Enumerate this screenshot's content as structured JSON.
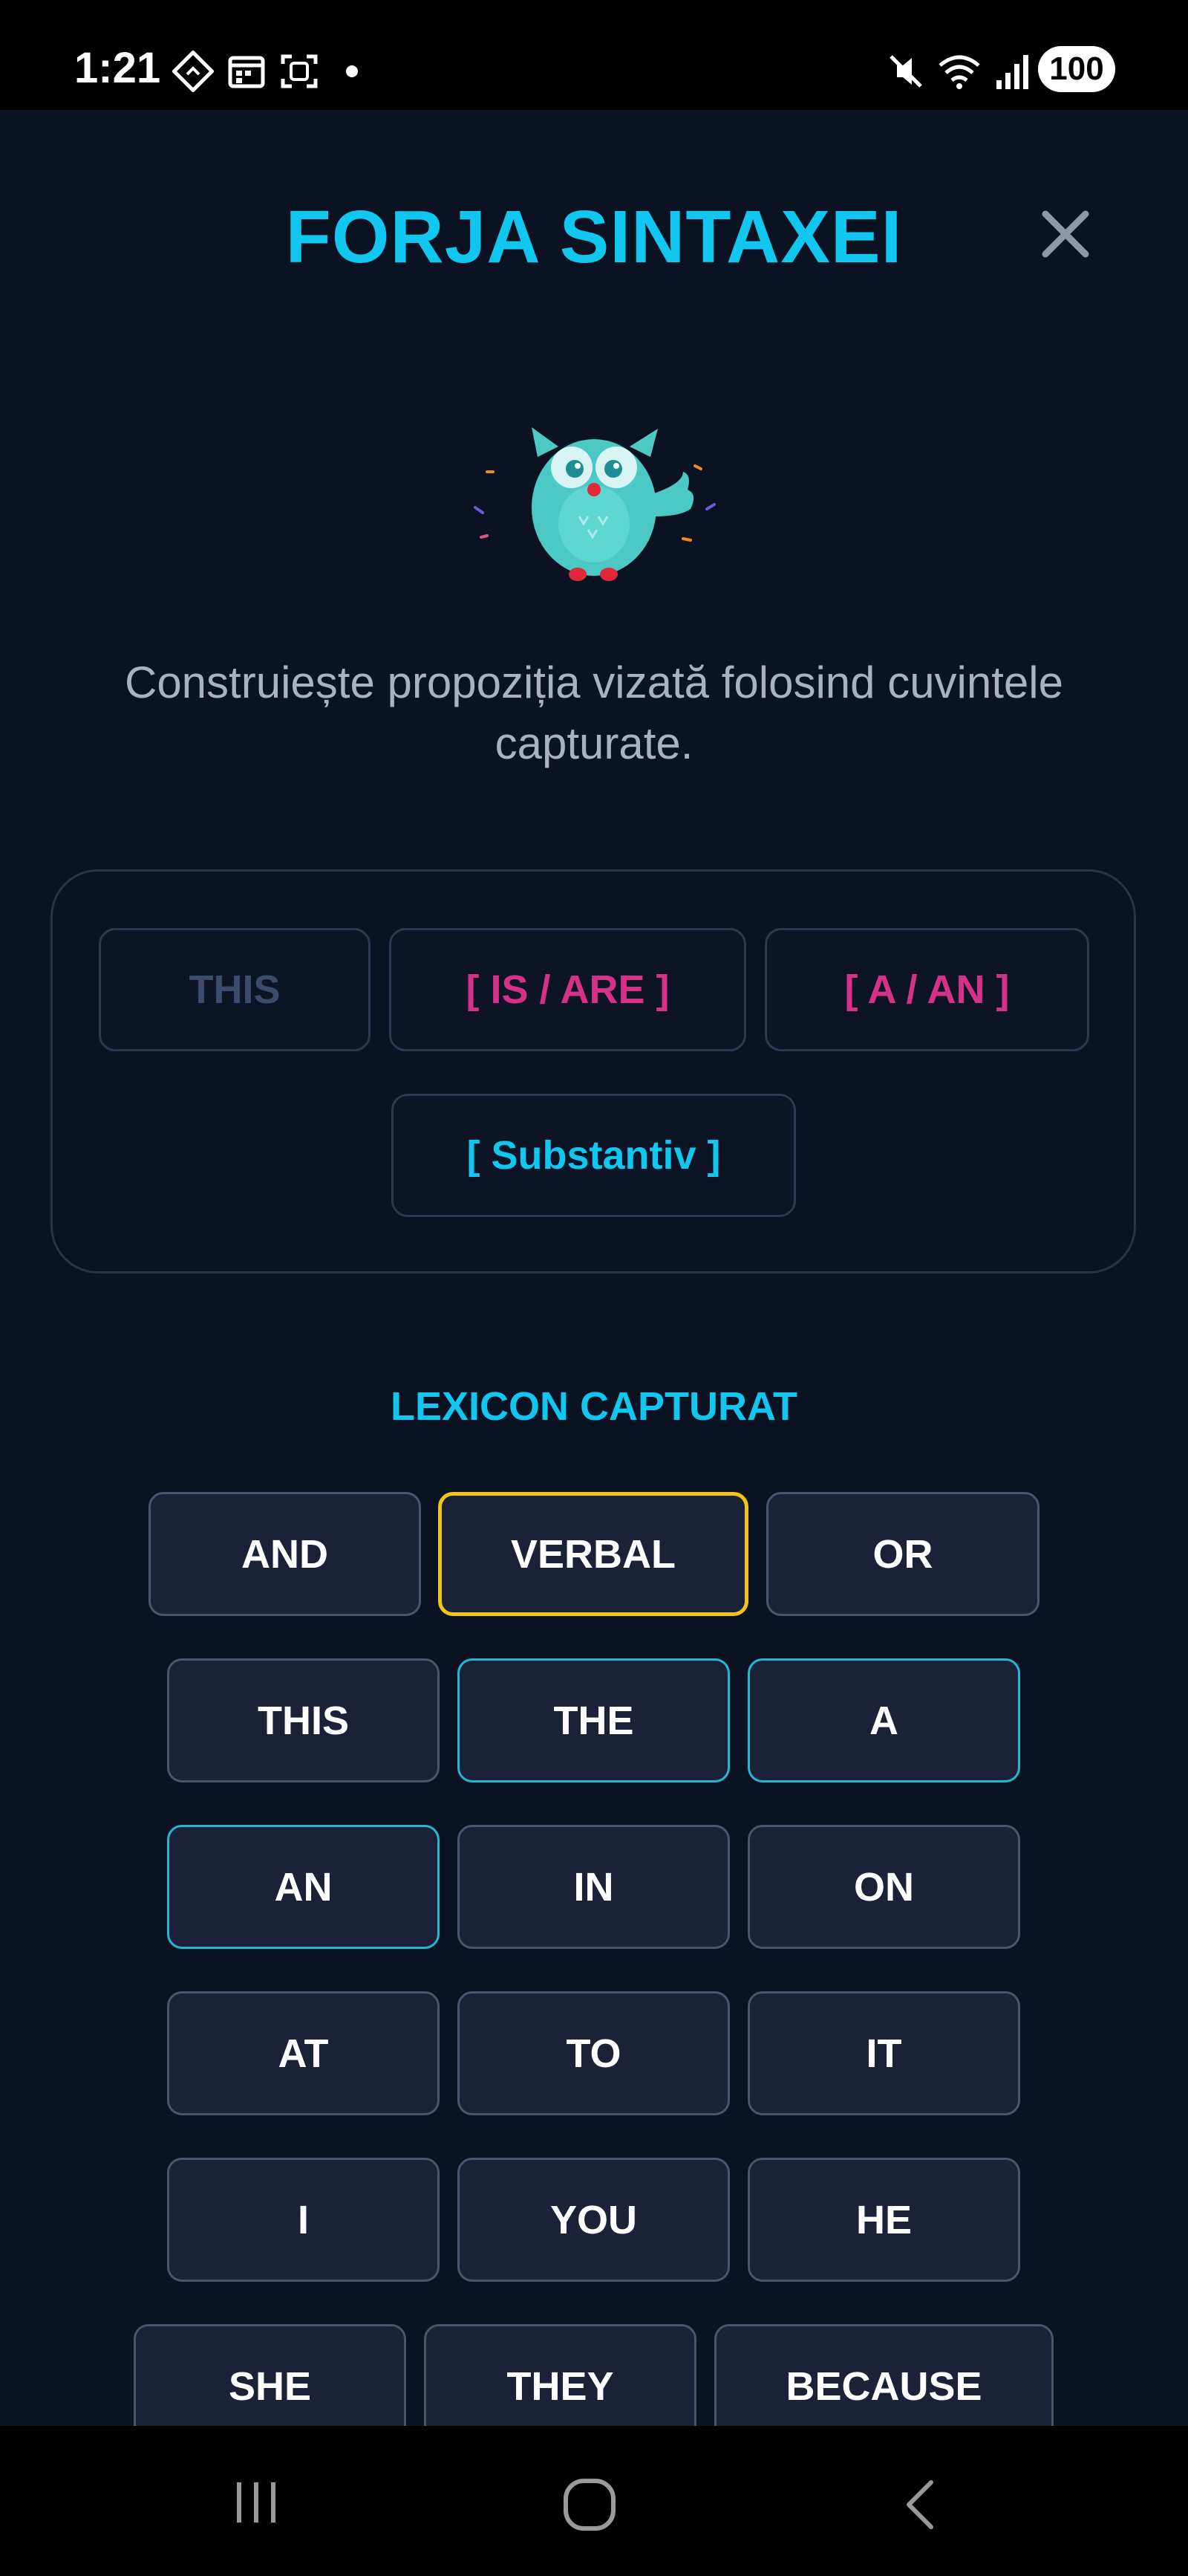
{
  "status_bar": {
    "time": "1:21",
    "battery": "100",
    "icons": [
      "navigation-icon",
      "calendar-icon",
      "screenshot-icon",
      "dot-icon",
      "mute-icon",
      "wifi-icon",
      "signal-icon"
    ]
  },
  "header": {
    "title": "FORJA SINTAXEI",
    "close_label": "close-icon"
  },
  "instruction": "Construiește propoziția vizată folosind cuvintele capturate.",
  "target_sentence": {
    "slots": [
      {
        "label": "THIS",
        "state": "filled"
      },
      {
        "label": "[ IS / ARE ]",
        "state": "placeholder-verb"
      },
      {
        "label": "[ A / AN ]",
        "state": "placeholder-article"
      },
      {
        "label": "[ Substantiv ]",
        "state": "placeholder-noun"
      }
    ]
  },
  "lexicon": {
    "heading": "LEXICON CAPTURAT",
    "words": [
      {
        "label": "AND",
        "state": "normal"
      },
      {
        "label": "VERBAL",
        "state": "highlighted-yellow"
      },
      {
        "label": "OR",
        "state": "normal"
      },
      {
        "label": "THIS",
        "state": "normal"
      },
      {
        "label": "THE",
        "state": "highlighted-cyan"
      },
      {
        "label": "A",
        "state": "highlighted-cyan"
      },
      {
        "label": "AN",
        "state": "highlighted-cyan"
      },
      {
        "label": "IN",
        "state": "normal"
      },
      {
        "label": "ON",
        "state": "normal"
      },
      {
        "label": "AT",
        "state": "normal"
      },
      {
        "label": "TO",
        "state": "normal"
      },
      {
        "label": "IT",
        "state": "normal"
      },
      {
        "label": "I",
        "state": "normal"
      },
      {
        "label": "YOU",
        "state": "normal"
      },
      {
        "label": "HE",
        "state": "normal"
      },
      {
        "label": "SHE",
        "state": "normal"
      },
      {
        "label": "THEY",
        "state": "normal"
      },
      {
        "label": "BECAUSE",
        "state": "normal"
      }
    ]
  },
  "colors": {
    "background": "#0b1222",
    "accent_cyan": "#11c7f0",
    "accent_magenta": "#d6318a",
    "selection_yellow": "#f0c419",
    "chip_background": "#1b2238"
  },
  "nav_bar": {
    "icons": [
      "recent-apps-icon",
      "home-icon",
      "back-icon"
    ]
  }
}
